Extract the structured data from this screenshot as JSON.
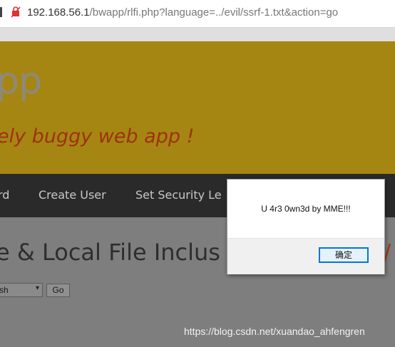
{
  "address_bar": {
    "host": "192.168.56.1",
    "path": "/bwapp/rlfi.php?language=../evil/ssrf-1.txt&action=go"
  },
  "header": {
    "logo_text": "pp",
    "tagline": "ely buggy web app !"
  },
  "nav": {
    "items": [
      {
        "label": "rd"
      },
      {
        "label": "Create User"
      },
      {
        "label": "Set Security Le"
      }
    ]
  },
  "main": {
    "title": "e & Local File Inclus",
    "title_tail": "/",
    "language_select": {
      "selected": "sh"
    },
    "go_label": "Go"
  },
  "watermark": "https://blog.csdn.net/xuandao_ahfengren",
  "alert": {
    "message": "U 4r3 0wn3d by MME!!!",
    "ok_label": "确定"
  },
  "colors": {
    "header_bg": "#a68612",
    "tagline": "#9d3210",
    "nav_bg": "#2a2a2a",
    "overlay_gray": "#7e7e7e",
    "dialog_accent": "#0078d7"
  }
}
